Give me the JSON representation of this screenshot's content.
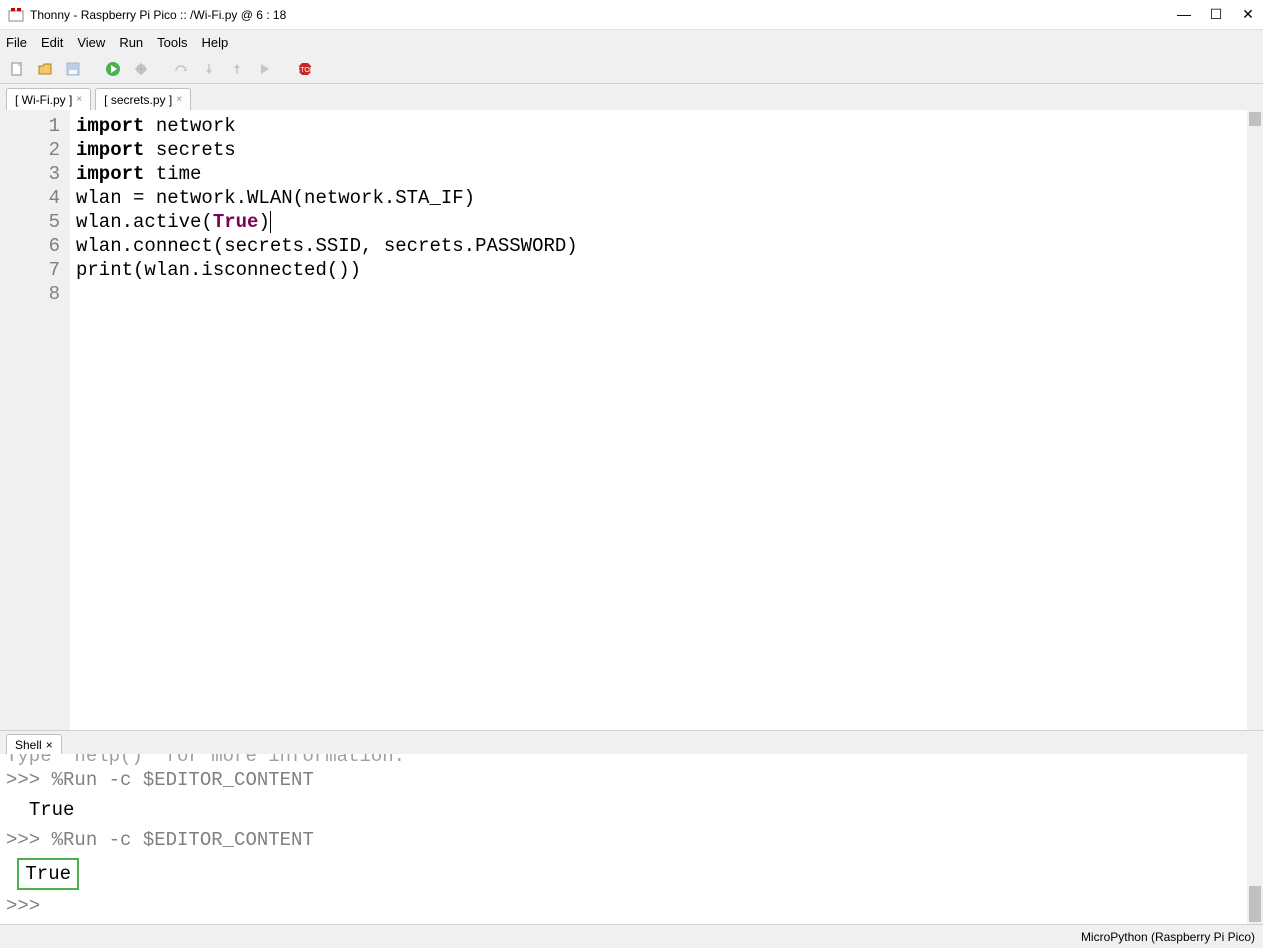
{
  "window": {
    "title": "Thonny  -  Raspberry Pi Pico :: /Wi-Fi.py  @  6 : 18"
  },
  "menu": {
    "file": "File",
    "edit": "Edit",
    "view": "View",
    "run": "Run",
    "tools": "Tools",
    "help": "Help"
  },
  "tabs": {
    "t0": {
      "label": "[ Wi-Fi.py ]"
    },
    "t1": {
      "label": "[ secrets.py ]"
    }
  },
  "gutter": {
    "l1": "1",
    "l2": "2",
    "l3": "3",
    "l4": "4",
    "l5": "5",
    "l6": "6",
    "l7": "7",
    "l8": "8"
  },
  "code": {
    "kw_import": "import",
    "l1_rest": " network",
    "l2_rest": " secrets",
    "l3_rest": " time",
    "l4": "",
    "l5": "wlan = network.WLAN(network.STA_IF)",
    "l6_a": "wlan.active(",
    "l6_true": "True",
    "l6_b": ")",
    "l7": "wlan.connect(secrets.SSID, secrets.PASSWORD)",
    "l8": "print(wlan.isconnected())"
  },
  "shell": {
    "tab": "Shell",
    "faded_top": "Type  help()  for more information.",
    "prompt": ">>> ",
    "cmd": "%Run -c $EDITOR_CONTENT",
    "out_true": "True",
    "out_true_boxed": "True",
    "prompt_only": ">>> "
  },
  "status": {
    "interpreter": "MicroPython (Raspberry Pi Pico)"
  }
}
